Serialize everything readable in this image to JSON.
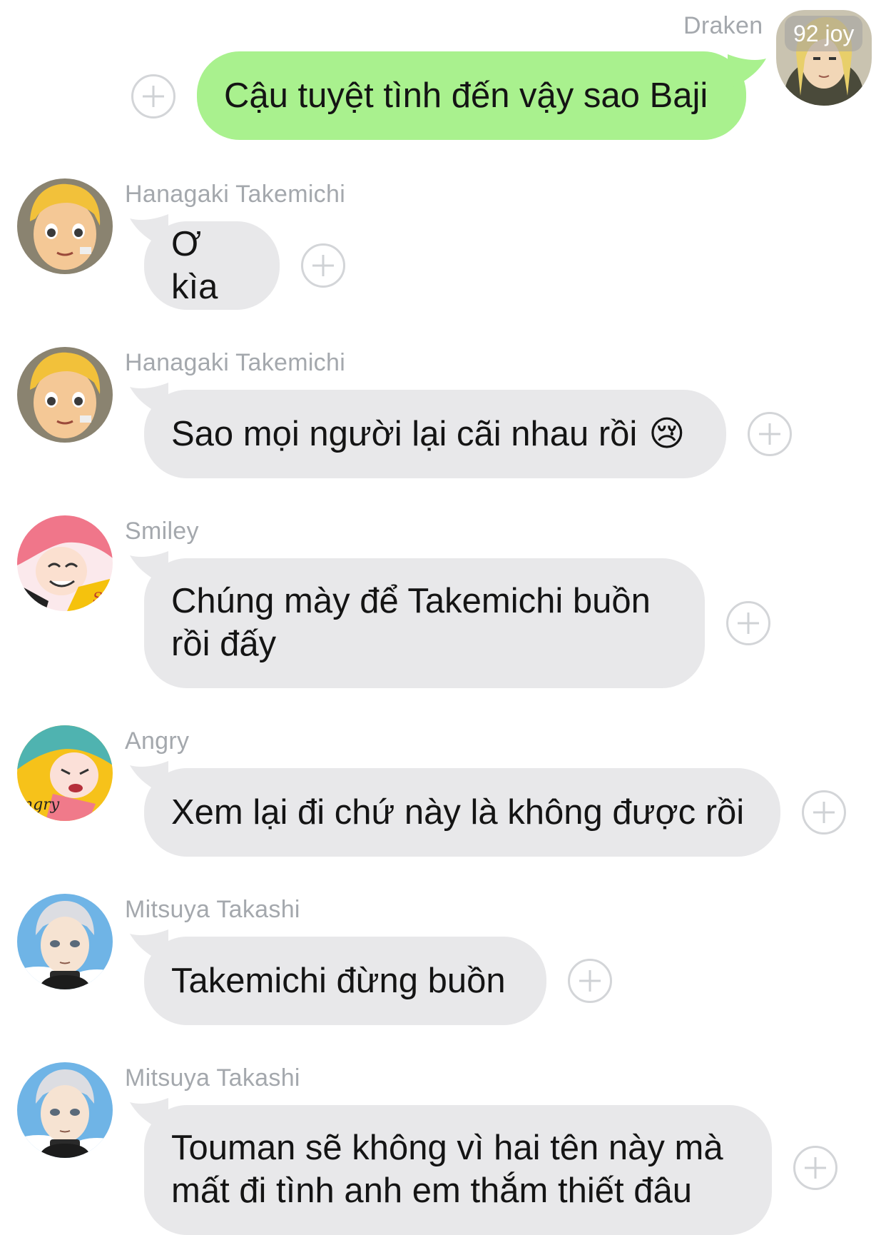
{
  "chat": {
    "outgoing": {
      "sender": "Draken",
      "badge": "92 joy",
      "text": "Cậu tuyệt tình đến vậy sao Baji",
      "avatar_icon": "draken-avatar"
    },
    "messages": [
      {
        "sender": "Hanagaki Takemichi",
        "text": "Ơ kìa",
        "avatar_icon": "takemichi-avatar"
      },
      {
        "sender": "Hanagaki Takemichi",
        "text": "Sao mọi người lại cãi nhau rồi",
        "emoji": "😢",
        "avatar_icon": "takemichi-avatar"
      },
      {
        "sender": "Smiley",
        "text_line1": "Chúng mày để Takemichi buồn",
        "text_line2": "rồi đấy",
        "avatar_icon": "smiley-avatar"
      },
      {
        "sender": "Angry",
        "text": "Xem lại đi chứ này là không được rồi",
        "avatar_icon": "angry-avatar"
      },
      {
        "sender": "Mitsuya Takashi",
        "text": "Takemichi đừng buồn",
        "avatar_icon": "mitsuya-avatar"
      },
      {
        "sender": "Mitsuya Takashi",
        "text_line1": "Touman sẽ không vì hai tên này mà",
        "text_line2": "mất đi tình anh em thắm thiết đâu",
        "avatar_icon": "mitsuya-avatar"
      }
    ]
  },
  "colors": {
    "outgoing_bubble": "#a9f18e",
    "incoming_bubble": "#e8e8ea",
    "sender_name": "#a4a8ad",
    "plus_icon": "#d3d5d8"
  },
  "icons": {
    "react_button": "plus-circle-icon",
    "crying_emoji": "crying-face-emoji"
  }
}
